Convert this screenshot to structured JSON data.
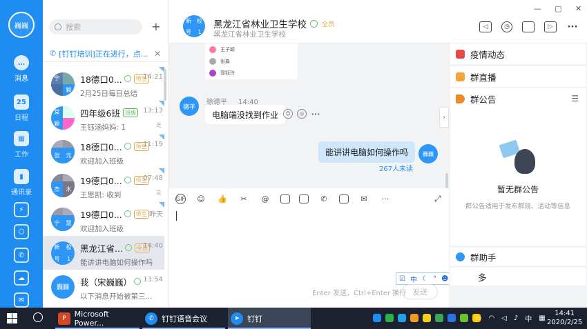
{
  "rail": {
    "avatar_text": "巍巍",
    "items": [
      {
        "label": "消息",
        "icon": "message-icon",
        "glyph": "…"
      },
      {
        "label": "日程",
        "icon": "calendar-icon",
        "glyph": "25"
      },
      {
        "label": "工作",
        "icon": "work-grid-icon",
        "glyph": "▦"
      },
      {
        "label": "通讯录",
        "icon": "contacts-icon",
        "glyph": "▮"
      },
      {
        "label": "",
        "icon": "lightning-icon",
        "glyph": "⚡"
      },
      {
        "label": "",
        "icon": "cube-icon",
        "glyph": "⬡"
      },
      {
        "label": "",
        "icon": "phone-icon",
        "glyph": "✆"
      },
      {
        "label": "",
        "icon": "cloud-icon",
        "glyph": "☁"
      },
      {
        "label": "",
        "icon": "mail-icon",
        "glyph": "✉"
      }
    ]
  },
  "convlist": {
    "search_placeholder": "搜索",
    "notice": "[钉钉培训]正在进行，点...",
    "conversations": [
      {
        "name": "18德口0...",
        "badge": "师生",
        "time": "14:21",
        "last": "2月25日每日总结",
        "avatar": [
          "宁",
          "颖"
        ]
      },
      {
        "name": "四年级6班",
        "badge": "班级",
        "time": "13:13",
        "last": "王钰涵妈妈: 1",
        "avatar": [
          "棠",
          "颖"
        ],
        "badge_green": true,
        "extra": "走"
      },
      {
        "name": "18德口0...",
        "badge": "师生",
        "time": "11:19",
        "last": "欢迎加入班级",
        "avatar": [
          "张",
          "元"
        ]
      },
      {
        "name": "19德口0...",
        "badge": "师生",
        "time": "07:48",
        "last": "王思凯: 收到",
        "avatar": [
          "杰",
          "木"
        ],
        "extra": "走"
      },
      {
        "name": "19德口0...",
        "badge": "师生",
        "time": "昨天",
        "last": "欢迎加入班级",
        "avatar": [
          "宁",
          "慧"
        ]
      },
      {
        "name": "黑龙江省...",
        "badge": "全员",
        "time": "14:40",
        "last": "能讲讲电脑如何操作吗",
        "avatar": [
          "新",
          "校",
          "号",
          "1"
        ],
        "active": true
      },
      {
        "name": "我（宋巍巍）",
        "badge": "",
        "time": "13:54",
        "last": "以下消息开始被第三...",
        "avatar_text": "巍巍"
      }
    ]
  },
  "chat_header": {
    "title": "黑龙江省林业卫生学校",
    "role": "全员",
    "subtitle": "黑龙江省林业卫生学校",
    "avatar": [
      "新",
      "校",
      "号",
      "1"
    ]
  },
  "chat": {
    "card_rows": [
      "王子颖",
      "张淼",
      "郭钰玲"
    ],
    "msg1": {
      "sender": "徐德平",
      "time": "14:40",
      "text": "电脑端没找到作业",
      "avatar": "德平"
    },
    "msg2": {
      "text": "能讲讲电脑如何操作吗",
      "avatar": "巍巍",
      "read": "267人未读"
    }
  },
  "toolbar": {
    "icons": [
      "GIF",
      "☺",
      "👍",
      "✂",
      "@",
      "▭",
      "▭",
      "✆",
      "▷",
      "✉",
      "···"
    ]
  },
  "input": {
    "send_hint": "Enter 发送，Ctrl+Enter 换行",
    "send_label": "发送",
    "ime": [
      "中",
      "☾",
      "°",
      "☻",
      "⚙"
    ]
  },
  "right_panel": {
    "epidemic": "疫情动态",
    "live": "群直播",
    "announcement": "群公告",
    "empty_title": "暂无群公告",
    "empty_desc": "群公告适用于发布群规、活动等信息",
    "assistant": "群助手",
    "more": "多"
  },
  "taskbar": {
    "apps": [
      "Microsoft Power...",
      "钉钉语音会议",
      "钉钉"
    ],
    "ime": "中",
    "time": "14:41",
    "date": "2020/2/25"
  },
  "colors": {
    "accent": "#1f8cf2",
    "bubble_me": "#cfe6fb",
    "badge_gold": "#e0a84a"
  }
}
